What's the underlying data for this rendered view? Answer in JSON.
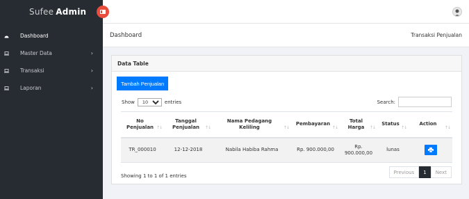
{
  "brand": {
    "prefix": "Sufee",
    "bold": "Admin"
  },
  "sidebar": {
    "items": [
      {
        "label": "Dashboard",
        "icon": "dashboard-icon",
        "has_arrow": false
      },
      {
        "label": "Master Data",
        "icon": "laptop-icon",
        "has_arrow": true
      },
      {
        "label": "Transaksi",
        "icon": "laptop-icon",
        "has_arrow": true
      },
      {
        "label": "Laporan",
        "icon": "laptop-icon",
        "has_arrow": true
      }
    ]
  },
  "breadcrumb": {
    "title": "Dashboard",
    "current": "Transaksi Penjualan"
  },
  "card": {
    "title": "Data Table",
    "add_button": "Tambah Penjualan",
    "length": {
      "prefix": "Show",
      "value": "10",
      "suffix": "entries"
    },
    "search_label": "Search:"
  },
  "table": {
    "headers": [
      [
        "No",
        "Penjualan"
      ],
      [
        "Tanggal",
        "Penjualan"
      ],
      [
        "Nama Pedagang",
        "Keliling"
      ],
      [
        "Pembayaran"
      ],
      [
        "Total",
        "Harga"
      ],
      [
        "Status"
      ],
      [
        "Action"
      ]
    ],
    "rows": [
      [
        "TR_000010",
        "12-12-2018",
        "Nabila Habiba Rahma",
        "Rp. 900.000,00",
        "Rp. 900.000,00",
        "lunas"
      ]
    ]
  },
  "info": "Showing 1 to 1 of 1 entries",
  "pager": {
    "prev": "Previous",
    "current": "1",
    "next": "Next"
  },
  "colors": {
    "sidebar": "#272c33",
    "primary": "#007bff",
    "toggle": "#e74c3c"
  }
}
